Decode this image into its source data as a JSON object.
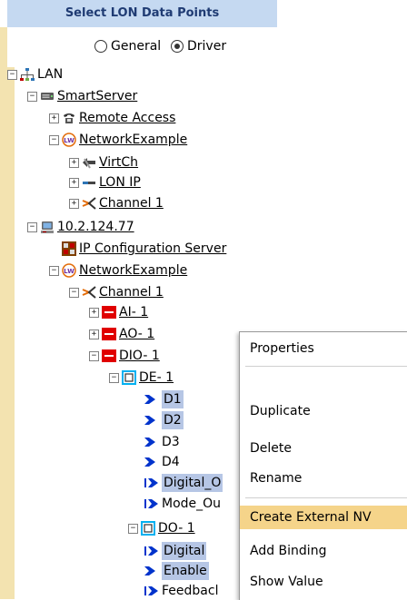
{
  "header": {
    "title": "Select LON Data Points"
  },
  "mode": {
    "general_label": "General",
    "driver_label": "Driver",
    "selected": "Driver"
  },
  "tree": {
    "lan": "LAN",
    "smartserver": "SmartServer",
    "remote_access": "Remote Access",
    "network_example_1": "NetworkExample",
    "virtch": "VirtCh",
    "lon_ip": "LON IP",
    "channel_1a": "Channel 1",
    "ip_node": "10.2.124.77",
    "ip_config_server": "IP Configuration Server",
    "network_example_2": "NetworkExample",
    "channel_1b": "Channel 1",
    "ai1": "AI- 1",
    "ao1": "AO- 1",
    "dio1": "DIO- 1",
    "de1": "DE- 1",
    "d1": "D1",
    "d2": "D2",
    "d3": "D3",
    "d4": "D4",
    "digital_o": "Digital_O",
    "mode_ou": "Mode_Ou",
    "do1": "DO- 1",
    "digital": "Digital",
    "enable": "Enable",
    "feedback": "Feedbacl"
  },
  "context_menu": {
    "items": [
      "Properties",
      "Duplicate",
      "Delete",
      "Rename",
      "Create External NV",
      "Add Binding",
      "Show Value"
    ],
    "highlighted": "Create External NV"
  },
  "colors": {
    "header_bg": "#c5d9f1",
    "gutter": "#f3e3b0",
    "menu_highlight": "#f5d48a",
    "selection": "#b6c6e5"
  }
}
